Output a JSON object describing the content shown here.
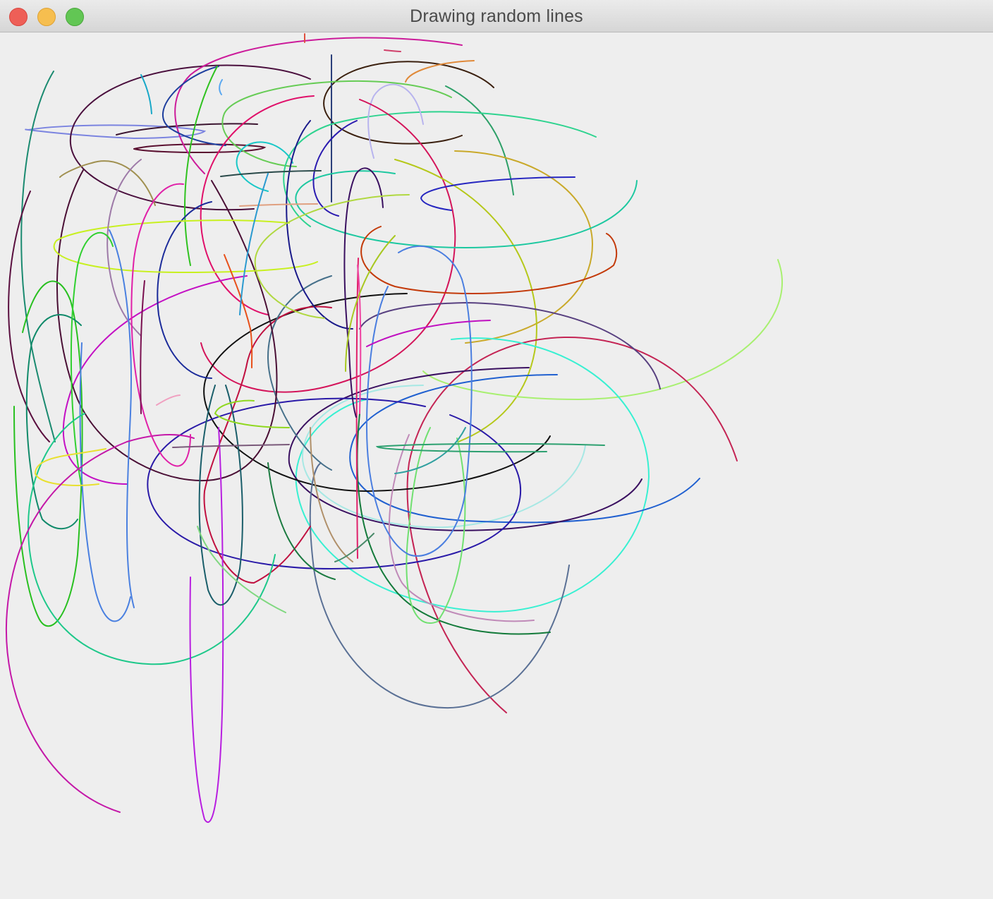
{
  "window": {
    "title": "Drawing random lines"
  },
  "buttons": {
    "close": "close-button",
    "minimize": "minimize-button",
    "zoom": "zoom-button"
  },
  "colors": {
    "titlebar": "#dcdcdc",
    "canvas_background": "#eeeeee",
    "close": "#ee5f57",
    "minimize": "#f6be4f",
    "zoom": "#62c654"
  }
}
